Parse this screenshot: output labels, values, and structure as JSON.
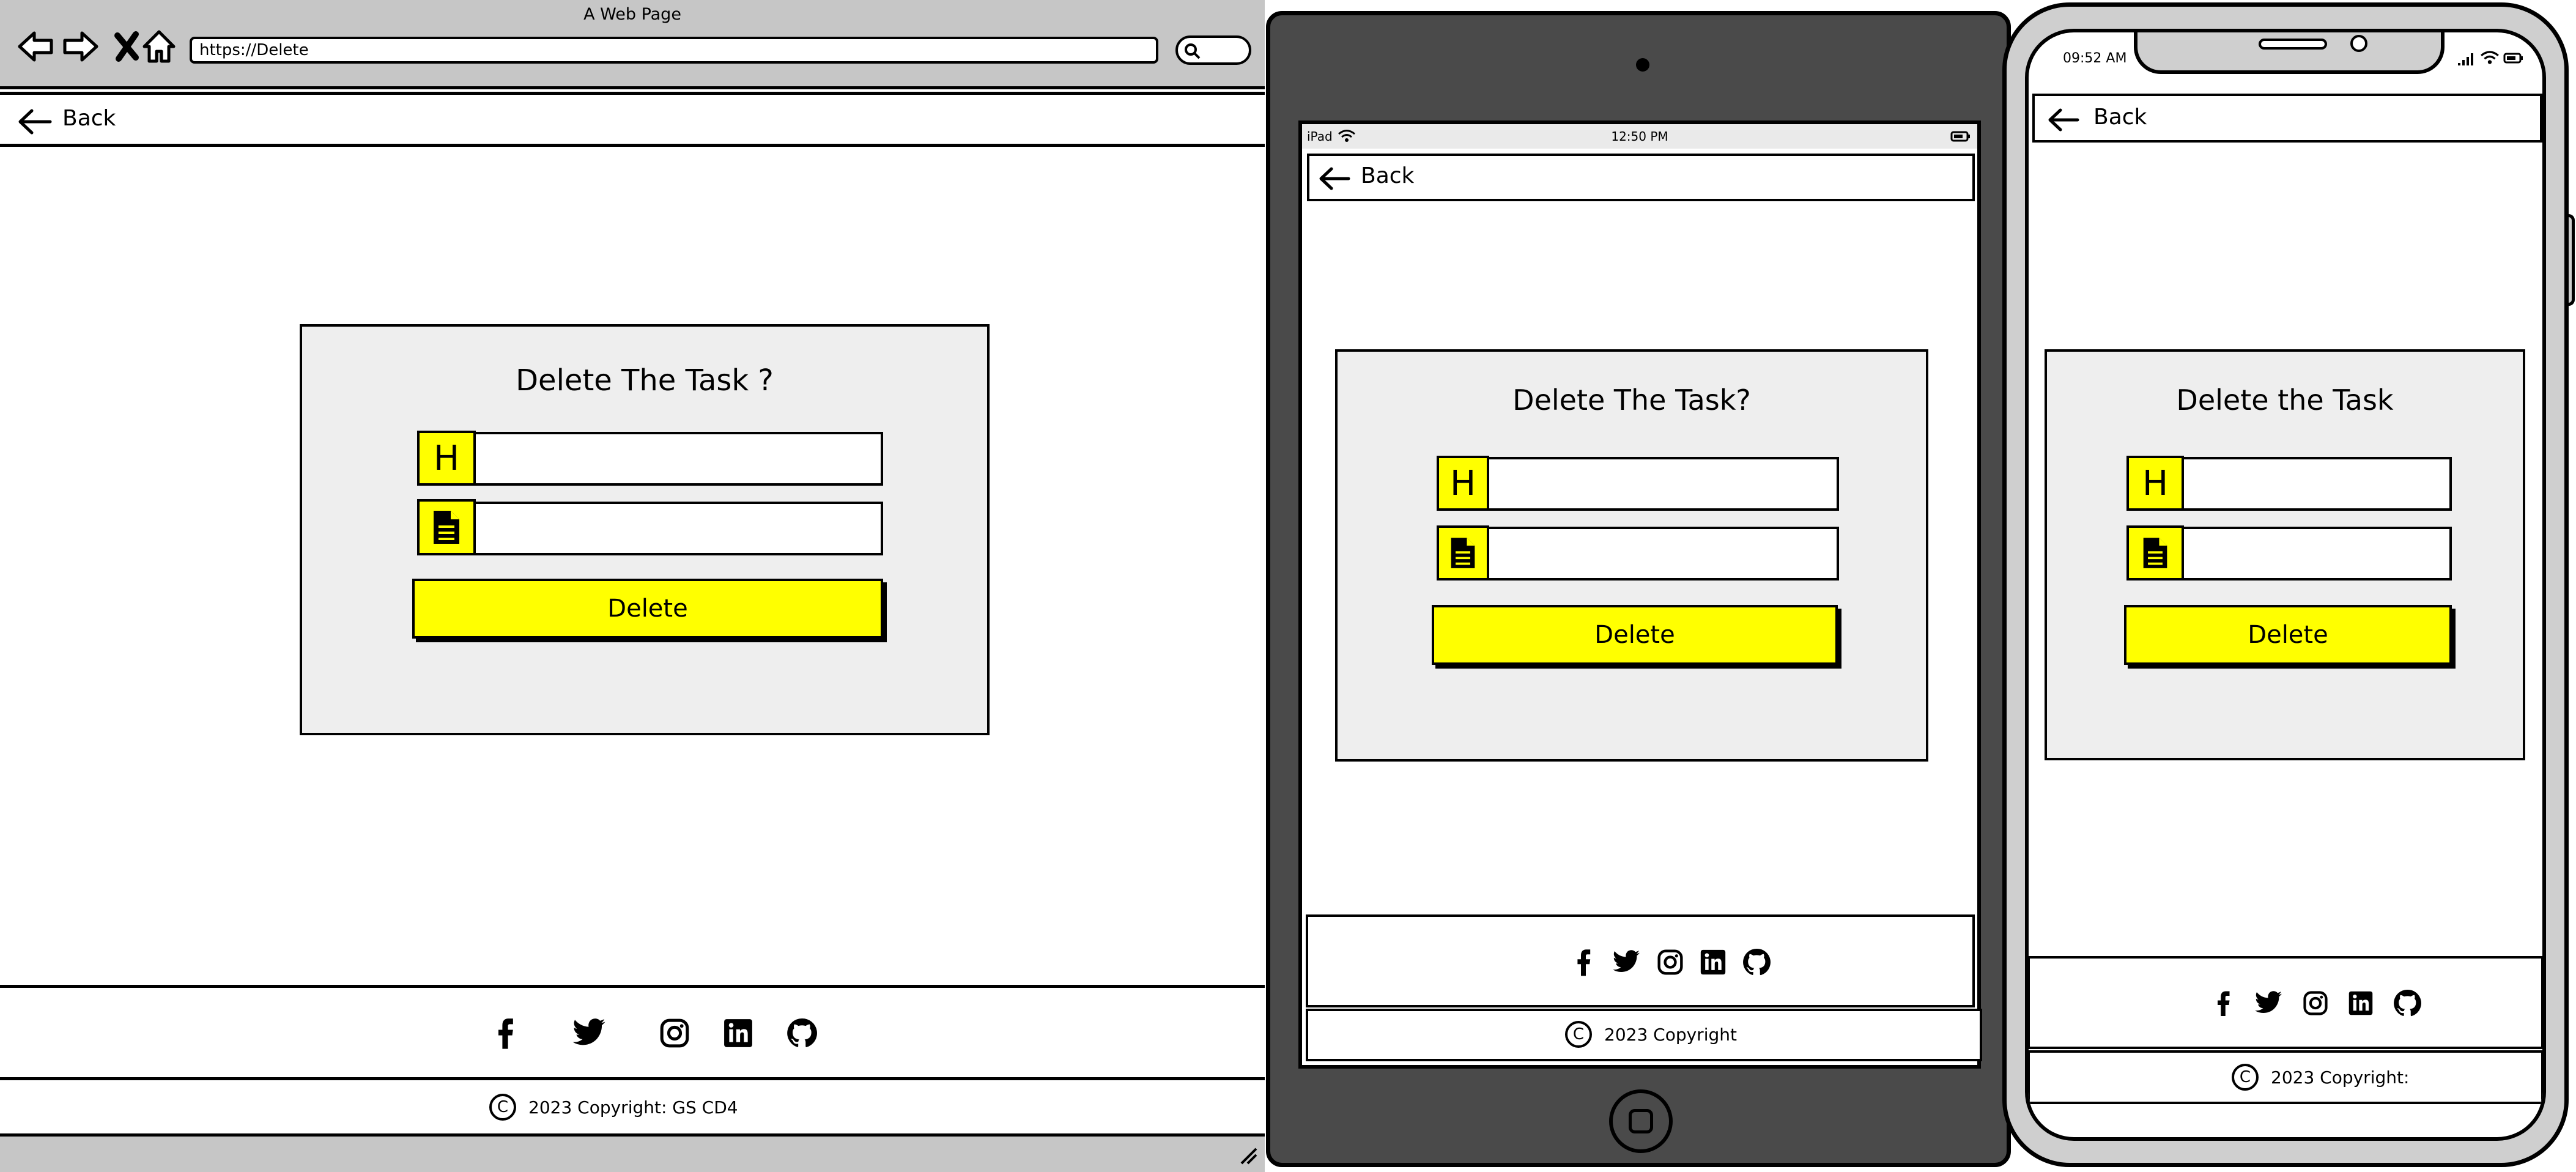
{
  "desktop": {
    "window_title": "A Web Page",
    "url": "https://Delete",
    "back_label": "Back",
    "card_title": "Delete The Task ?",
    "heading_icon_label": "H",
    "delete_label": "Delete",
    "copyright": "2023 Copyright: GS CD4"
  },
  "tablet": {
    "status_device": "iPad",
    "status_time": "12:50 PM",
    "back_label": "Back",
    "card_title": "Delete The Task?",
    "heading_icon_label": "H",
    "delete_label": "Delete",
    "copyright": "2023 Copyright"
  },
  "phone": {
    "status_time": "09:52 AM",
    "back_label": "Back",
    "card_title": "Delete the Task",
    "heading_icon_label": "H",
    "delete_label": "Delete",
    "copyright": "2023 Copyright:"
  },
  "copyright_symbol": "C",
  "social_icons": [
    "facebook-icon",
    "twitter-icon",
    "instagram-icon",
    "linkedin-icon",
    "github-icon"
  ],
  "colors": {
    "accent": "#ffff00",
    "card_bg": "#eeeeee",
    "chrome": "#c6c6c6",
    "tablet_body": "#4a4a4a",
    "phone_body": "#cfcfcf"
  }
}
